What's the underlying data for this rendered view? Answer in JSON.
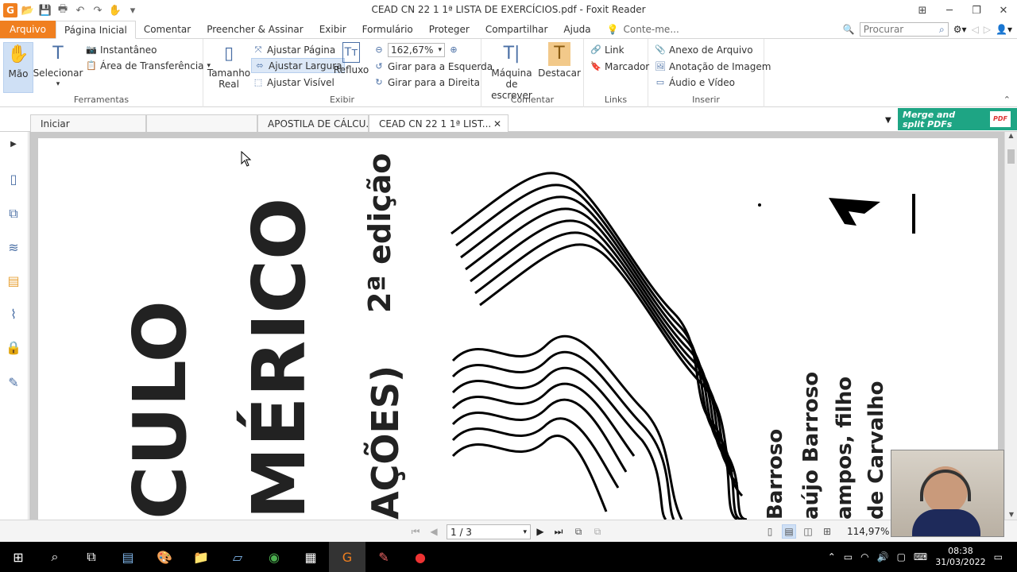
{
  "titlebar": {
    "title": "CEAD CN 22 1 1ª LISTA DE EXERCÍCIOS.pdf - Foxit Reader",
    "app_logo": "G"
  },
  "menu": {
    "file": "Arquivo",
    "tabs": [
      "Página Inicial",
      "Comentar",
      "Preencher & Assinar",
      "Exibir",
      "Formulário",
      "Proteger",
      "Compartilhar",
      "Ajuda"
    ],
    "tell_me": "Conte-me...",
    "search_placeholder": "Procurar"
  },
  "ribbon": {
    "tools": {
      "hand": "Mão",
      "select": "Selecionar",
      "snapshot": "Instantâneo",
      "clipboard": "Área de Transferência",
      "label": "Ferramentas"
    },
    "view": {
      "actual_size_1": "Tamanho",
      "actual_size_2": "Real",
      "fit_page": "Ajustar Página",
      "fit_width": "Ajustar Largura",
      "fit_visible": "Ajustar Visível",
      "reflow": "Refluxo",
      "zoom": "162,67%",
      "rotate_left": "Girar para a Esquerda",
      "rotate_right": "Girar para a Direita",
      "label": "Exibir"
    },
    "comment": {
      "typewriter_1": "Máquina de",
      "typewriter_2": "escrever",
      "highlight": "Destacar",
      "label": "Comentar"
    },
    "links": {
      "link": "Link",
      "bookmark": "Marcador",
      "label": "Links"
    },
    "insert": {
      "file_attachment": "Anexo de Arquivo",
      "image_annotation": "Anotação de Imagem",
      "audio_video": "Áudio e Vídeo",
      "label": "Inserir"
    }
  },
  "doc_tabs": [
    "Iniciar",
    "",
    "APOSTILA DE CÁLCU...",
    "CEAD CN 22 1 1ª LIST..."
  ],
  "merge_banner": {
    "line1": "Merge and",
    "line2": "split PDFs"
  },
  "page_text": {
    "edition": "2ª edição",
    "title1": "CULO",
    "title2": "MÉRICO",
    "title3": "AÇÕES)",
    "author1": "Barroso",
    "author2": "aújo Barroso",
    "author3": "ampos, filho",
    "author4": "de Carvalho"
  },
  "status": {
    "page": "1 / 3",
    "zoom": "114,97%"
  },
  "clock": {
    "time": "08:38",
    "date": "31/03/2022"
  }
}
